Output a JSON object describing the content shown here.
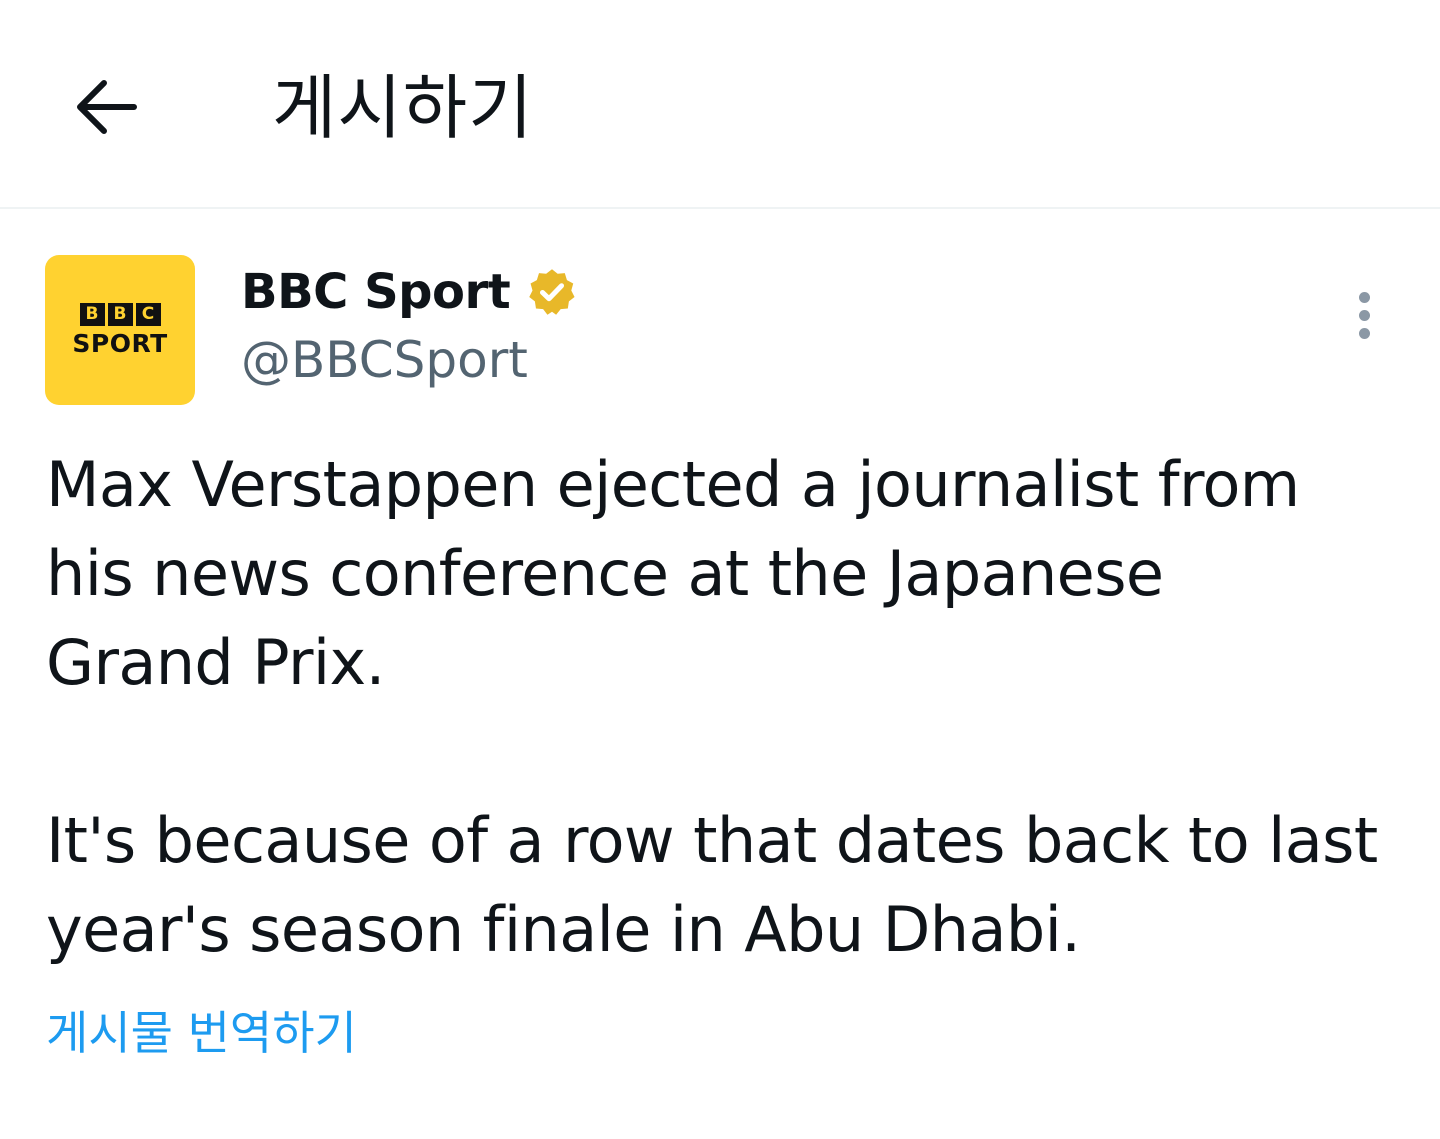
{
  "header": {
    "back_icon": "arrow-left-icon",
    "title": "게시하기"
  },
  "post": {
    "author": {
      "avatar_logo": {
        "blocks": [
          "B",
          "B",
          "C"
        ],
        "word": "SPORT",
        "background": "#ffd230"
      },
      "display_name": "BBC Sport",
      "verified_icon": "verified-badge-icon",
      "verified_color": "#e8b829",
      "handle": "@BBCSport"
    },
    "more_icon": "more-vertical-icon",
    "text": {
      "paragraph_1_lines": [
        "Max Verstappen ejected a journalist from",
        "his news conference at the Japanese",
        "Grand Prix."
      ],
      "paragraph_2_lines": [
        "It's because of a row that dates back to last",
        "year's season finale in Abu Dhabi."
      ]
    },
    "translate_label": "게시물 번역하기",
    "link_color": "#1d9bf0"
  }
}
